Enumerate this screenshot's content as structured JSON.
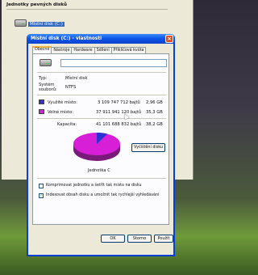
{
  "background_window": {
    "header": "Jednotky pevných disků",
    "drive_label": "Místní disk (C:)"
  },
  "dialog": {
    "title": "Místní disk (C:) - vlastnosti",
    "close_glyph": "×",
    "tabs": [
      {
        "label": "Obecné",
        "active": true
      },
      {
        "label": "Nástroje",
        "active": false
      },
      {
        "label": "Hardware",
        "active": false
      },
      {
        "label": "Sdílení",
        "active": false
      },
      {
        "label": "Přiklíčová kvóta",
        "active": false
      }
    ],
    "name_value": "",
    "type_label": "Typ:",
    "type_value": "Místní disk",
    "fs_label_1": "Systém",
    "fs_label_2": "souborů:",
    "fs_value": "NTFS",
    "used": {
      "label": "Využité místo:",
      "bytes": "3 109 747 712 bajtů",
      "size": "2,96 GB",
      "color": "#2f2fd3"
    },
    "free": {
      "label": "Volné místo:",
      "bytes": "37 911 941 120 bajtů",
      "size": "35,3 GB",
      "color": "#d81fd8"
    },
    "capacity": {
      "label": "Kapacita:",
      "bytes": "41 101 688 832 bajtů",
      "size": "38,2 GB"
    },
    "used_fraction": 0.0757,
    "drive_caption": "Jednotka C",
    "cleanup_button": "Vyčištění disku",
    "compress_label": "Komprimovat jednotku a šetřit tak místo na disku",
    "compress_checked": false,
    "index_label": "Indexovat obsah disku a umožnit tak rychlejší vyhledávání",
    "index_checked": true,
    "ok": "OK",
    "cancel": "Storno",
    "apply": "Použít"
  }
}
